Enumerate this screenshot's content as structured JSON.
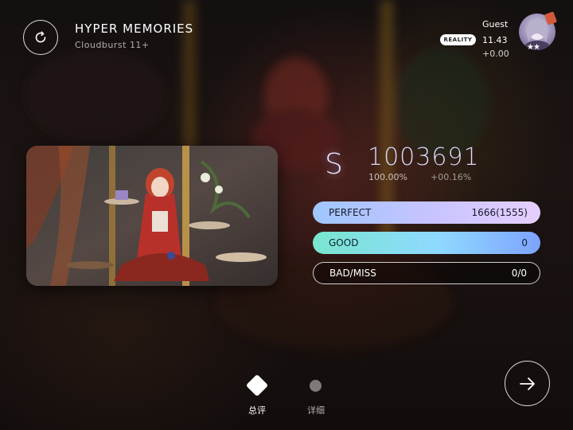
{
  "song": {
    "title": "HYPER MEMORIES",
    "subtitle": "Cloudburst 11+"
  },
  "player": {
    "name": "Guest",
    "mode_badge": "REALITY",
    "rks": "11.43",
    "rks_delta": "+0.00",
    "stars": "★★"
  },
  "result": {
    "grade": "S",
    "score": "1003691",
    "accuracy": "100.00%",
    "accuracy_delta": "+00.16%"
  },
  "judgements": {
    "perfect": {
      "label": "PERFECT",
      "value": "1666(1555)"
    },
    "good": {
      "label": "GOOD",
      "value": "0"
    },
    "bad_miss": {
      "label": "BAD/MISS",
      "value": "0/0"
    }
  },
  "tabs": {
    "summary": "总评",
    "detail": "详细"
  },
  "icons": {
    "retry": "retry-icon",
    "next": "arrow-right-icon",
    "summary": "diamond-icon",
    "detail": "dot-icon"
  },
  "colors": {
    "perfect_start": "#9ec6ff",
    "perfect_end": "#e6cfff",
    "good_start": "#78e6cf",
    "good_end": "#7ea3ff",
    "badge": "#ffffff",
    "avatar_tag": "#d25a3a"
  }
}
